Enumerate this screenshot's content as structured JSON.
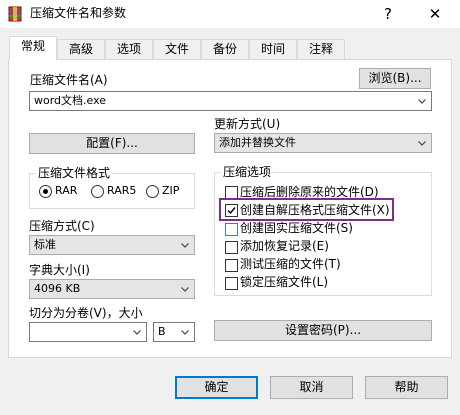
{
  "window": {
    "title": "压缩文件名和参数",
    "help_glyph": "?",
    "close_glyph": "✕"
  },
  "tabs": [
    {
      "label": "常规"
    },
    {
      "label": "高级"
    },
    {
      "label": "选项"
    },
    {
      "label": "文件"
    },
    {
      "label": "备份"
    },
    {
      "label": "时间"
    },
    {
      "label": "注释"
    }
  ],
  "archive": {
    "name_label": "压缩文件名(A)",
    "name_value": "word文档.exe",
    "browse_label": "浏览(B)..."
  },
  "update": {
    "label": "更新方式(U)",
    "value": "添加并替换文件"
  },
  "profile_label": "配置(F)...",
  "format": {
    "title": "压缩文件格式",
    "options": [
      {
        "label": "RAR",
        "selected": true
      },
      {
        "label": "RAR5",
        "selected": false
      },
      {
        "label": "ZIP",
        "selected": false
      }
    ]
  },
  "method": {
    "label": "压缩方式(C)",
    "value": "标准"
  },
  "dictionary": {
    "label": "字典大小(I)",
    "value": "4096 KB"
  },
  "split": {
    "label": "切分为分卷(V)，大小",
    "value": "",
    "unit": "B"
  },
  "options": {
    "title": "压缩选项",
    "items": [
      {
        "label": "压缩后删除原来的文件(D)",
        "checked": false
      },
      {
        "label": "创建自解压格式压缩文件(X)",
        "checked": true
      },
      {
        "label": "创建固实压缩文件(S)",
        "checked": false
      },
      {
        "label": "添加恢复记录(E)",
        "checked": false
      },
      {
        "label": "测试压缩的文件(T)",
        "checked": false
      },
      {
        "label": "锁定压缩文件(L)",
        "checked": false
      }
    ]
  },
  "password_label": "设置密码(P)...",
  "footer": {
    "ok": "确定",
    "cancel": "取消",
    "help": "帮助"
  },
  "colors": {
    "highlight_box": "#7b2d8b",
    "accent": "#0078d7"
  }
}
